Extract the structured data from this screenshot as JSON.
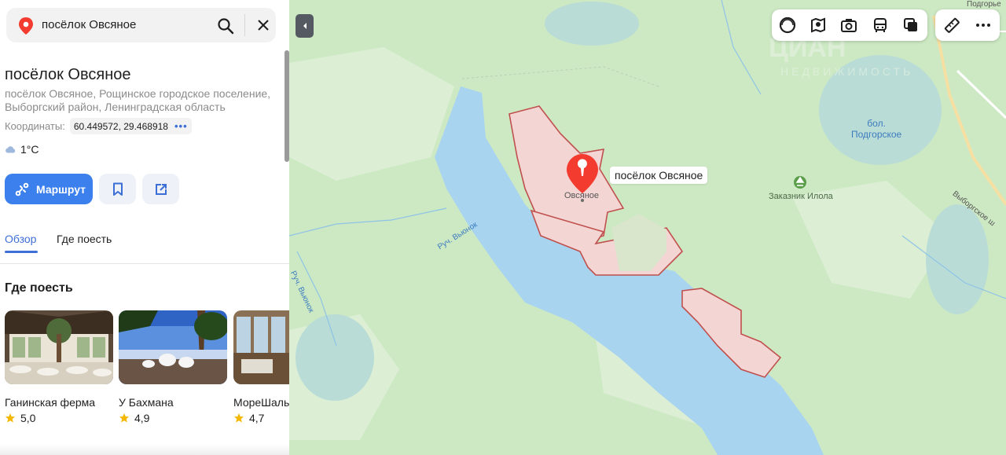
{
  "search": {
    "query": "посёлок Овсяное",
    "icons": [
      "location-pin-icon",
      "search-icon",
      "close-icon"
    ]
  },
  "place": {
    "title": "посёлок Овсяное",
    "address": "посёлок Овсяное, Рощинское городское поселение, Выборгский район, Ленинградская область",
    "coords_label": "Координаты:",
    "coords_value": "60.449572, 29.468918",
    "weather": "1°C"
  },
  "actions": {
    "route_label": "Маршрут"
  },
  "tabs": [
    {
      "label": "Обзор",
      "active": true
    },
    {
      "label": "Где поесть",
      "active": false
    }
  ],
  "section": {
    "title": "Где поесть"
  },
  "cards": [
    {
      "name": "Ганинская ферма",
      "rating": "5,0"
    },
    {
      "name": "У Бахмана",
      "rating": "4,9"
    },
    {
      "name": "МореШаль",
      "rating": "4,7"
    }
  ],
  "map": {
    "pin_label": "посёлок Овсяное",
    "labels": {
      "village": "Овсяное",
      "swamp": "бол.\nПодгорское",
      "reserve": "Заказник Илола",
      "stream": "руч. Вьюнок",
      "stream2": "Руч. Вьюнок",
      "road": "Выборгское ш",
      "top_corner": "Подгорье"
    },
    "colors": {
      "water": "#a8d4f0",
      "forest": "#c8e6bf",
      "settlement": "#f3d6d4",
      "boundary": "#c0504d",
      "pin": "#f43b2f"
    },
    "toolbar_icons": [
      "layers-icon",
      "panorama-icon",
      "photo-icon",
      "transit-icon",
      "map-style-icon",
      "ruler-icon",
      "more-icon"
    ]
  }
}
